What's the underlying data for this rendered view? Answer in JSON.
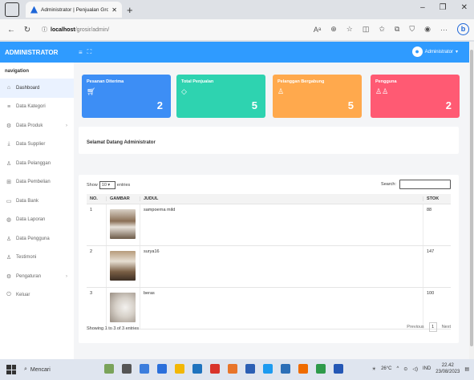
{
  "browser": {
    "tab_title": "Administrator | Penjualan Grosir",
    "url_host": "localhost",
    "url_path": "/grosir/admin/"
  },
  "header": {
    "brand": "ADMINISTRATOR",
    "user": "Administrator"
  },
  "sidebar": {
    "heading": "navigation",
    "items": [
      {
        "label": "Dashboard",
        "icon": "home-icon"
      },
      {
        "label": "Data Kategori",
        "icon": "list-icon"
      },
      {
        "label": "Data Produk",
        "icon": "gear-icon"
      },
      {
        "label": "Data Supplier",
        "icon": "download-icon"
      },
      {
        "label": "Data Pelanggan",
        "icon": "user-icon"
      },
      {
        "label": "Data Pembelian",
        "icon": "cart-icon"
      },
      {
        "label": "Data Bank",
        "icon": "card-icon"
      },
      {
        "label": "Data Laporan",
        "icon": "report-icon"
      },
      {
        "label": "Data Pengguna",
        "icon": "user-icon"
      },
      {
        "label": "Testimoni",
        "icon": "user-icon"
      },
      {
        "label": "Pengaturan",
        "icon": "gear-icon"
      },
      {
        "label": "Keluar",
        "icon": "power-icon"
      }
    ]
  },
  "cards": [
    {
      "label": "Pesanan Diterima",
      "value": "2",
      "color": "#3d8ef5",
      "icon": "cart-icon"
    },
    {
      "label": "Total Penjualan",
      "value": "5",
      "color": "#2ed3b0",
      "icon": "tag-icon"
    },
    {
      "label": "Pelanggan Bergabung",
      "value": "5",
      "color": "#ffa94d",
      "icon": "user-icon"
    },
    {
      "label": "Pengguna",
      "value": "2",
      "color": "#ff5a73",
      "icon": "users-icon"
    }
  ],
  "welcome": "Selamat Datang Administrator",
  "table": {
    "show": "Show",
    "entries_value": "10",
    "entries": "entries",
    "search_label": "Search:",
    "columns": [
      "NO.",
      "GAMBAR",
      "JUDUL",
      "STOK"
    ],
    "rows": [
      {
        "no": "1",
        "judul": "sampoerna mild",
        "stok": "88"
      },
      {
        "no": "2",
        "judul": "surya16",
        "stok": "147"
      },
      {
        "no": "3",
        "judul": "beras",
        "stok": "100"
      }
    ],
    "info": "Showing 1 to 3 of 3 entries",
    "previous": "Previous",
    "page": "1",
    "next": "Next"
  },
  "taskbar": {
    "search": "Mencari",
    "weather": "26°C",
    "lang": "IND",
    "time": "22.42",
    "date": "23/08/2023"
  }
}
